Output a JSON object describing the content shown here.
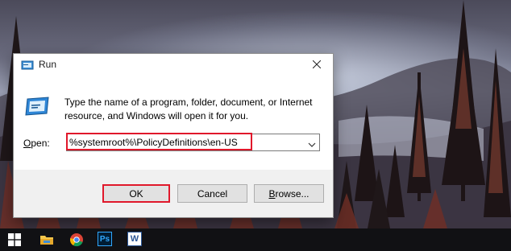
{
  "dialog": {
    "title": "Run",
    "description": "Type the name of a program, folder, document, or Internet resource, and Windows will open it for you.",
    "open_label_accel": "O",
    "open_label_rest": "pen:",
    "input_value": "%systemroot%\\PolicyDefinitions\\en-US",
    "buttons": {
      "ok": "OK",
      "cancel": "Cancel",
      "browse_accel": "B",
      "browse_rest": "rowse..."
    },
    "icons": {
      "title": "run-icon",
      "large": "run-icon",
      "close": "close-icon",
      "dropdown": "chevron-down-icon"
    },
    "highlight_color": "#e0182b"
  },
  "taskbar": {
    "icons": [
      "windows-start-icon",
      "file-explorer-icon",
      "chrome-icon",
      "photoshop-icon",
      "word-icon"
    ],
    "photoshop_label": "Ps",
    "word_label": "W"
  }
}
